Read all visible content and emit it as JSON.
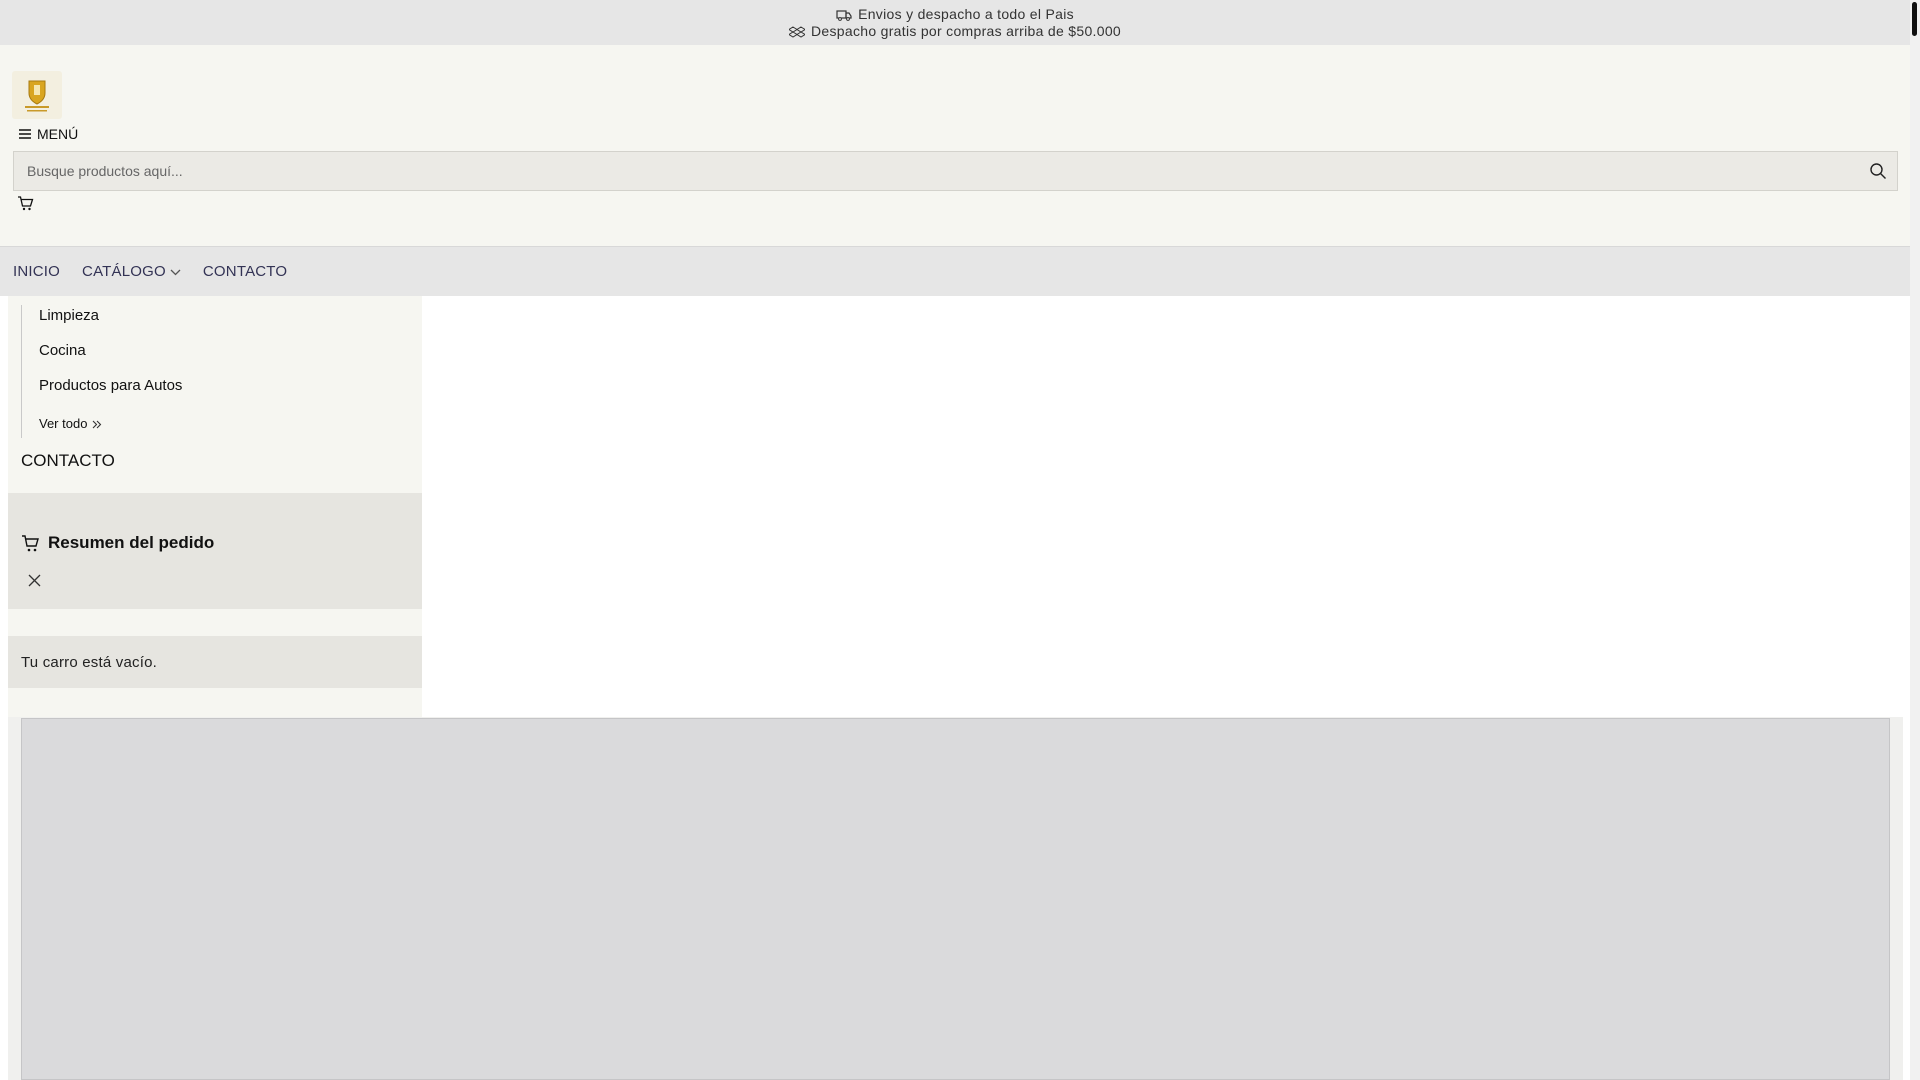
{
  "announcement": {
    "line1": "Envios y despacho a todo el Pais",
    "line2": "Despacho gratis por compras arriba de $50.000",
    "line1_icon": "truck-icon",
    "line2_icon": "dropbox-icon"
  },
  "header": {
    "logo_icon": "shield-logo-icon",
    "menu_label": "MENÚ",
    "search_placeholder": "Busque productos aquí..."
  },
  "nav": {
    "items": [
      {
        "label": "INICIO"
      },
      {
        "label": "CATÁLOGO"
      },
      {
        "label": "CONTACTO"
      }
    ]
  },
  "side_menu": {
    "categories": [
      "Limpieza",
      "Cocina",
      "Productos para Autos"
    ],
    "view_all": "Ver todo",
    "contact": "CONTACTO"
  },
  "cart": {
    "title": "Resumen del pedido",
    "empty_message": "Tu carro está vacío."
  },
  "colors": {
    "announce_bg": "#e6e6e6",
    "header_bg": "#f6f6f1",
    "nav_text": "#333355",
    "frame_bg": "#dadadc"
  }
}
